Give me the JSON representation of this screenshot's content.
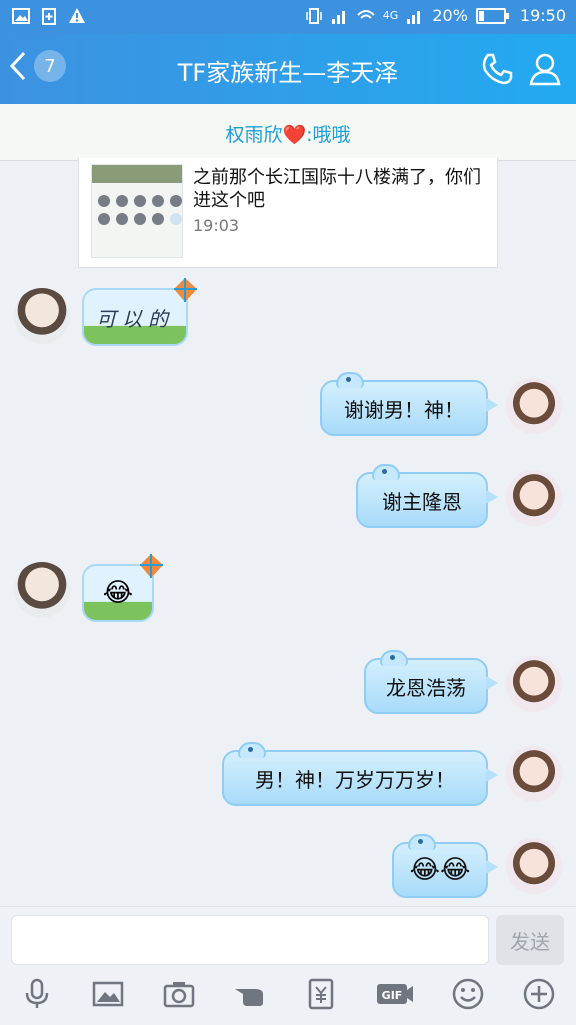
{
  "statusbar": {
    "battery": "20%",
    "time": "19:50",
    "network": "4G"
  },
  "header": {
    "back_badge": "7",
    "title": "TF家族新生—李天泽"
  },
  "pinned": {
    "text": "权雨欣❤️:哦哦"
  },
  "shared_card": {
    "text": "之前那个长江国际十八楼满了，你们进这个吧",
    "time": "19:03"
  },
  "messages": [
    {
      "side": "left",
      "type": "sticker",
      "text": "可以的"
    },
    {
      "side": "right",
      "type": "text",
      "text": "谢谢男！神！"
    },
    {
      "side": "right",
      "type": "text",
      "text": "谢主隆恩"
    },
    {
      "side": "left",
      "type": "sticker",
      "text": "😂"
    },
    {
      "side": "right",
      "type": "text",
      "text": "龙恩浩荡"
    },
    {
      "side": "right",
      "type": "text",
      "text": "男！神！万岁万万岁！"
    },
    {
      "side": "right",
      "type": "text",
      "text": "😂😂"
    }
  ],
  "input": {
    "placeholder": "",
    "send_label": "发送"
  },
  "tools": [
    "voice-icon",
    "image-icon",
    "camera-icon",
    "hand-icon",
    "red-packet-icon",
    "gif-icon",
    "emoji-icon",
    "plus-icon"
  ],
  "colors": {
    "header": "#2b9ceb",
    "bubble": "#b4e0fa",
    "pinned_text": "#1a9fd8"
  }
}
